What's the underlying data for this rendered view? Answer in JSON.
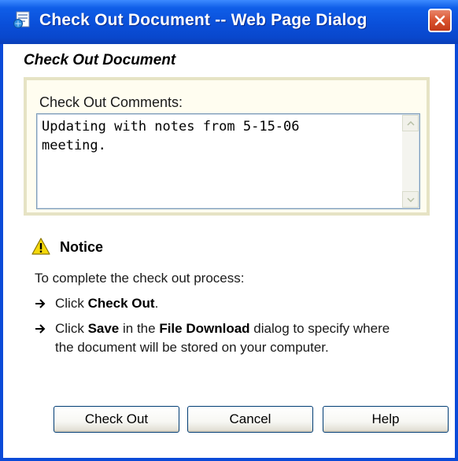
{
  "window": {
    "title": "Check Out Document -- Web Page Dialog"
  },
  "form": {
    "heading": "Check Out Document",
    "comments_label": "Check Out Comments:",
    "comments_value": "Updating with notes from 5-15-06\nmeeting."
  },
  "notice": {
    "title": "Notice",
    "intro": "To complete the check out process:",
    "step1": {
      "prefix": "Click ",
      "bold": "Check Out",
      "suffix": "."
    },
    "step2": {
      "prefix": "Click ",
      "bold1": "Save",
      "middle": " in the ",
      "bold2": "File Download",
      "suffix": " dialog to specify where the document will be stored on your computer."
    }
  },
  "buttons": {
    "check_out": "Check Out",
    "cancel": "Cancel",
    "help": "Help"
  },
  "colors": {
    "titlebar": "#0a4fd9",
    "close_button": "#d9522e",
    "comments_border": "#e6e3c4",
    "warning_icon": "#f5d90a"
  }
}
